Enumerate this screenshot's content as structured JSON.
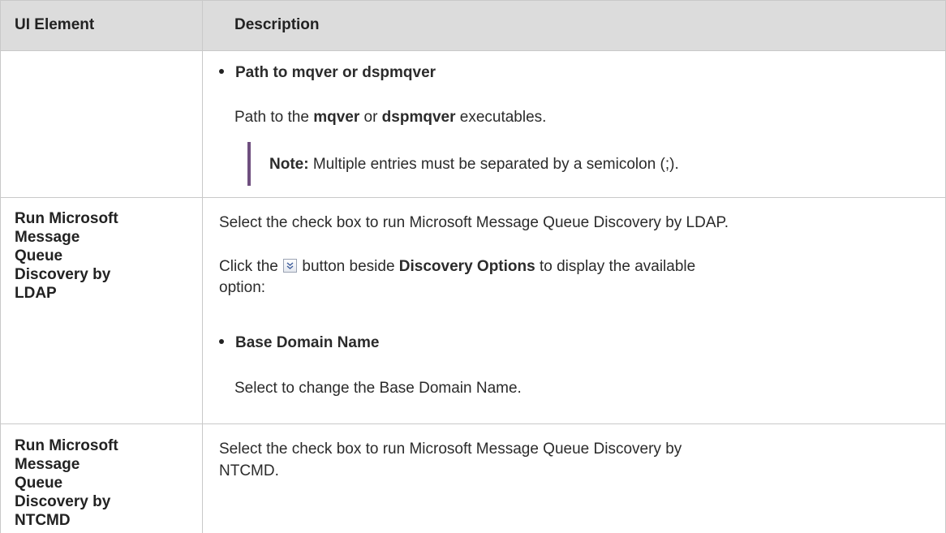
{
  "table": {
    "headers": {
      "col1": "UI Element",
      "col2": "Description"
    },
    "rows": [
      {
        "element": "",
        "bullet_title": "Path to mqver or dspmqver",
        "path_line": {
          "prefix": "Path to the ",
          "term1": "mqver",
          "mid": " or ",
          "term2": "dspmqver",
          "suffix": " executables."
        },
        "note": {
          "label": "Note:",
          "text": " Multiple entries must be separated by a semicolon (;)."
        }
      },
      {
        "element": "Run Microsoft Message Queue Discovery by LDAP",
        "line1": "Select the check box to run Microsoft Message Queue Discovery by LDAP.",
        "line2": {
          "prefix": "Click the ",
          "suffix_pre": " button beside ",
          "bold": "Discovery Options",
          "suffix": " to display the available",
          "cont": "option:"
        },
        "bullet_title": "Base Domain Name",
        "bullet_desc": "Select to change the Base Domain Name."
      },
      {
        "element": "Run Microsoft Message Queue Discovery by NTCMD",
        "line1a": "Select the check box to run Microsoft Message Queue Discovery by",
        "line1b": "NTCMD."
      }
    ]
  },
  "icons": {
    "expand_button": "double-chevron-down-icon"
  }
}
